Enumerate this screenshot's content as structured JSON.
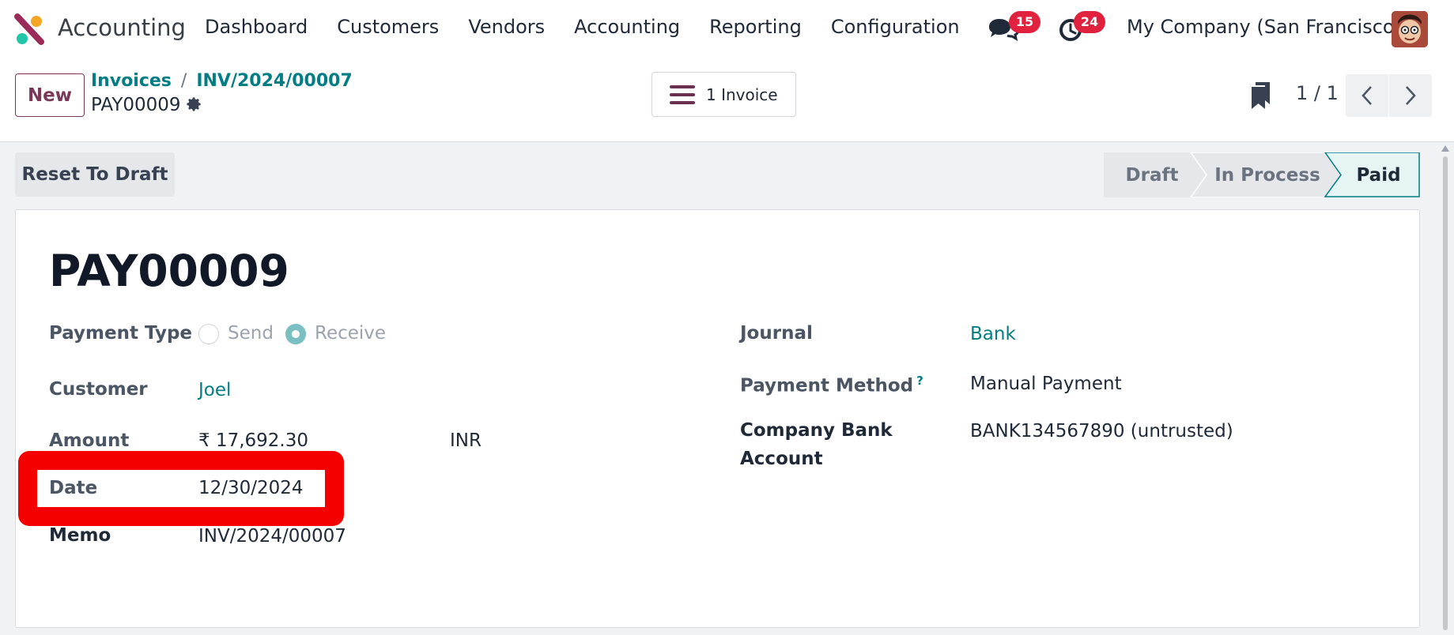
{
  "app": {
    "name": "Accounting",
    "menu": [
      "Dashboard",
      "Customers",
      "Vendors",
      "Accounting",
      "Reporting",
      "Configuration"
    ],
    "messages_count": "15",
    "activities_count": "24",
    "company": "My Company (San Francisco)"
  },
  "control": {
    "new_label": "New",
    "breadcrumb": [
      "Invoices",
      "INV/2024/00007"
    ],
    "breadcrumb_sep": "/",
    "record_name": "PAY00009",
    "invoice_button": "1 Invoice",
    "pager": "1 / 1"
  },
  "status": {
    "reset_label": "Reset To Draft",
    "steps": [
      "Draft",
      "In Process",
      "Paid"
    ],
    "active_step": "Paid"
  },
  "form": {
    "title": "PAY00009",
    "payment_type_label": "Payment Type",
    "send_label": "Send",
    "receive_label": "Receive",
    "customer_label": "Customer",
    "customer_value": "Joel",
    "amount_label": "Amount",
    "amount_value": "₹ 17,692.30",
    "currency_value": "INR",
    "date_label": "Date",
    "date_value": "12/30/2024",
    "memo_label": "Memo",
    "memo_value": "INV/2024/00007",
    "journal_label": "Journal",
    "journal_value": "Bank",
    "payment_method_label": "Payment Method",
    "payment_method_help": "?",
    "payment_method_value": "Manual Payment",
    "company_bank_label_1": "Company Bank",
    "company_bank_label_2": "Account",
    "company_bank_value": "BANK134567890 (untrusted)"
  },
  "colors": {
    "brand": "#7a3858",
    "link": "#017e84",
    "badge": "#e0223f",
    "highlight": "#f40000"
  }
}
